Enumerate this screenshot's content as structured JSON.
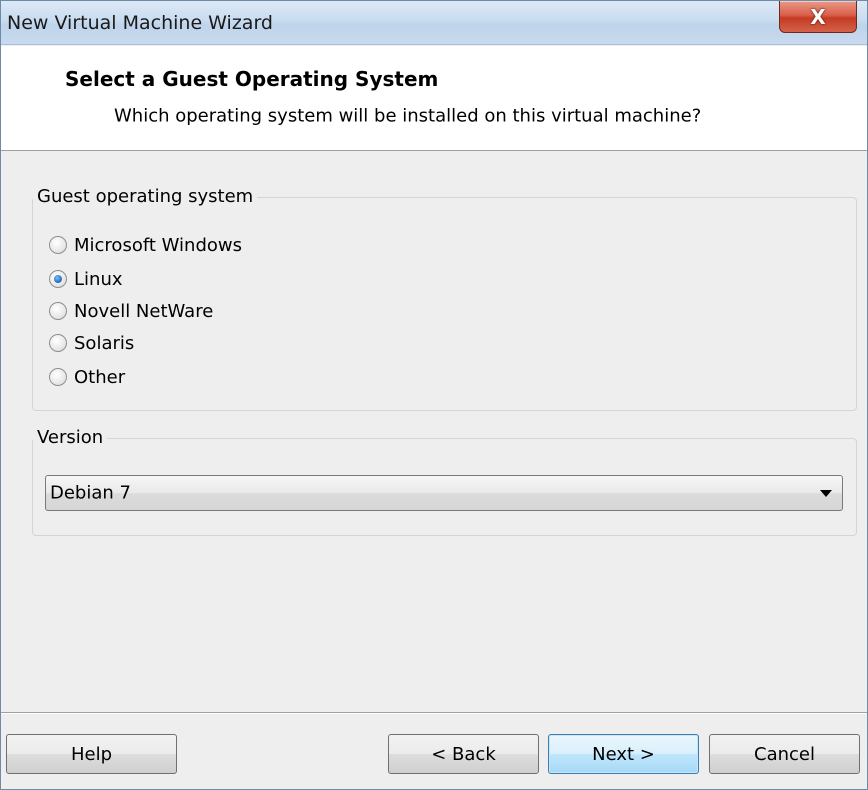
{
  "window": {
    "title": "New Virtual Machine Wizard",
    "close_label": "X"
  },
  "header": {
    "title": "Select a Guest Operating System",
    "subtitle": "Which operating system will be installed on this virtual machine?"
  },
  "guest_os": {
    "label": "Guest operating system",
    "options": [
      {
        "label": "Microsoft Windows",
        "selected": false
      },
      {
        "label": "Linux",
        "selected": true
      },
      {
        "label": "Novell NetWare",
        "selected": false
      },
      {
        "label": "Solaris",
        "selected": false
      },
      {
        "label": "Other",
        "selected": false
      }
    ]
  },
  "version": {
    "label": "Version",
    "selected": "Debian 7"
  },
  "buttons": {
    "help": "Help",
    "back": "< Back",
    "next": "Next >",
    "cancel": "Cancel"
  },
  "colors": {
    "accent_radio": "#2a71c4",
    "close_button": "#c53b23",
    "default_button_border": "#3c7fb1"
  }
}
